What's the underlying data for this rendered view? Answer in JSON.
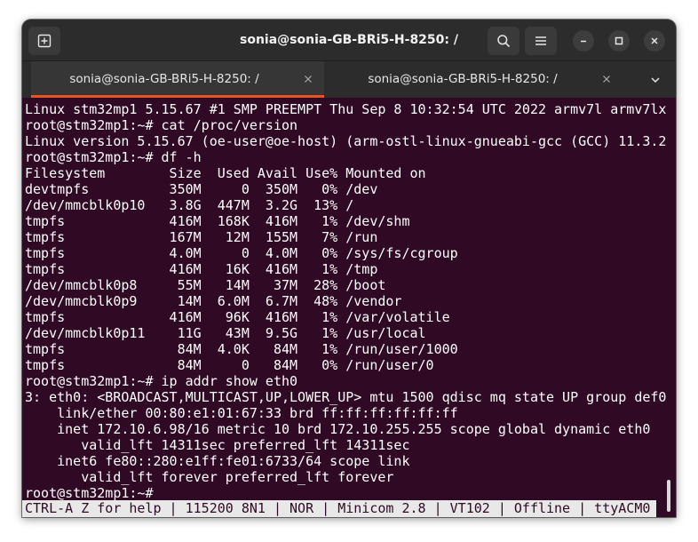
{
  "window": {
    "title": "sonia@sonia-GB-BRi5-H-8250: /"
  },
  "icons": {
    "new_tab": "new-tab-icon",
    "search": "search-icon",
    "menu": "hamburger-menu-icon",
    "minimize": "minimize-icon",
    "maximize": "maximize-icon",
    "close": "close-icon",
    "tab_close": "close-icon",
    "tab_list": "chevron-down-icon"
  },
  "colors": {
    "terminal_bg": "#300a24",
    "accent": "#e95420",
    "titlebar_bg": "#2c2c2c"
  },
  "tabs": [
    {
      "label": "sonia@sonia-GB-BRi5-H-8250: /",
      "active": true
    },
    {
      "label": "sonia@sonia-GB-BRi5-H-8250: /",
      "active": false
    }
  ],
  "terminal": {
    "lines": [
      "Linux stm32mp1 5.15.67 #1 SMP PREEMPT Thu Sep 8 10:32:54 UTC 2022 armv7l armv7lx",
      "root@stm32mp1:~# cat /proc/version",
      "Linux version 5.15.67 (oe-user@oe-host) (arm-ostl-linux-gnueabi-gcc (GCC) 11.3.2",
      "root@stm32mp1:~# df -h",
      "Filesystem        Size  Used Avail Use% Mounted on",
      "devtmpfs          350M     0  350M   0% /dev",
      "/dev/mmcblk0p10   3.8G  447M  3.2G  13% /",
      "tmpfs             416M  168K  416M   1% /dev/shm",
      "tmpfs             167M   12M  155M   7% /run",
      "tmpfs             4.0M     0  4.0M   0% /sys/fs/cgroup",
      "tmpfs             416M   16K  416M   1% /tmp",
      "/dev/mmcblk0p8     55M   14M   37M  28% /boot",
      "/dev/mmcblk0p9     14M  6.0M  6.7M  48% /vendor",
      "tmpfs             416M   96K  416M   1% /var/volatile",
      "/dev/mmcblk0p11    11G   43M  9.5G   1% /usr/local",
      "tmpfs              84M  4.0K   84M   1% /run/user/1000",
      "tmpfs              84M     0   84M   0% /run/user/0",
      "root@stm32mp1:~# ip addr show eth0",
      "3: eth0: <BROADCAST,MULTICAST,UP,LOWER_UP> mtu 1500 qdisc mq state UP group def0",
      "    link/ether 00:80:e1:01:67:33 brd ff:ff:ff:ff:ff:ff",
      "    inet 172.10.6.98/16 metric 10 brd 172.10.255.255 scope global dynamic eth0",
      "       valid_lft 14311sec preferred_lft 14311sec",
      "    inet6 fe80::280:e1ff:fe01:6733/64 scope link",
      "       valid_lft forever preferred_lft forever",
      "root@stm32mp1:~#"
    ],
    "status_bar": "CTRL-A Z for help | 115200 8N1 | NOR | Minicom 2.8 | VT102 | Offline | ttyACM0"
  }
}
